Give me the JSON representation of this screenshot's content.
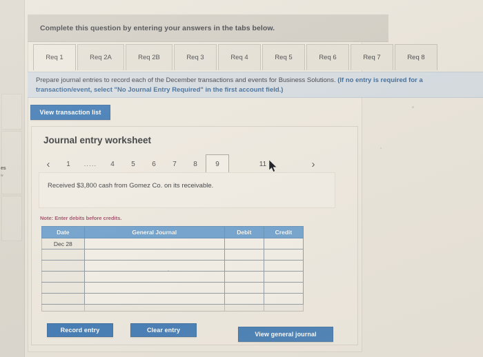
{
  "banner": {
    "text": "Complete this question by entering your answers in the tabs below."
  },
  "tabs": [
    {
      "label": "Req 1",
      "selected": true
    },
    {
      "label": "Req 2A",
      "selected": false
    },
    {
      "label": "Req 2B",
      "selected": false
    },
    {
      "label": "Req 3",
      "selected": false
    },
    {
      "label": "Req 4",
      "selected": false
    },
    {
      "label": "Req 5",
      "selected": false
    },
    {
      "label": "Req 6",
      "selected": false
    },
    {
      "label": "Req 7",
      "selected": false
    },
    {
      "label": "Req 8",
      "selected": false
    }
  ],
  "instructions": {
    "line1_plain": "Prepare journal entries to record each of the December transactions and events for Business Solutions. ",
    "line1_highlight": "(If no entry is required for a",
    "line2_highlight": "transaction/event, select \"No Journal Entry Required\" in the first account field.)"
  },
  "buttons": {
    "view_transaction_list": "View transaction list",
    "record_entry": "Record entry",
    "clear_entry": "Clear entry",
    "view_general_journal": "View general journal"
  },
  "worksheet": {
    "title": "Journal entry worksheet",
    "pagination": {
      "prev_icon": "‹",
      "next_icon": "›",
      "ellipsis": ".....",
      "pages": [
        "1",
        "4",
        "5",
        "6",
        "7",
        "8",
        "9",
        "11"
      ],
      "active_page": "9"
    },
    "transaction_description": "Received $3,800 cash from Gomez Co. on its receivable.",
    "note": "Note: Enter debits before credits.",
    "table": {
      "headers": [
        "Date",
        "General Journal",
        "Debit",
        "Credit"
      ],
      "rows": [
        {
          "date": "Dec 28",
          "general_journal": "",
          "debit": "",
          "credit": ""
        },
        {
          "date": "",
          "general_journal": "",
          "debit": "",
          "credit": ""
        },
        {
          "date": "",
          "general_journal": "",
          "debit": "",
          "credit": ""
        },
        {
          "date": "",
          "general_journal": "",
          "debit": "",
          "credit": ""
        },
        {
          "date": "",
          "general_journal": "",
          "debit": "",
          "credit": ""
        },
        {
          "date": "",
          "general_journal": "",
          "debit": "",
          "credit": ""
        }
      ]
    }
  },
  "left_strip": {
    "label": "es",
    "sublabel": "w"
  },
  "colors": {
    "accent_blue": "#1f64ab",
    "table_header_blue": "#5b95c9",
    "instruction_bar": "#cdd6de",
    "note_red": "#8a3550",
    "page_background": "#e6e1d7"
  }
}
